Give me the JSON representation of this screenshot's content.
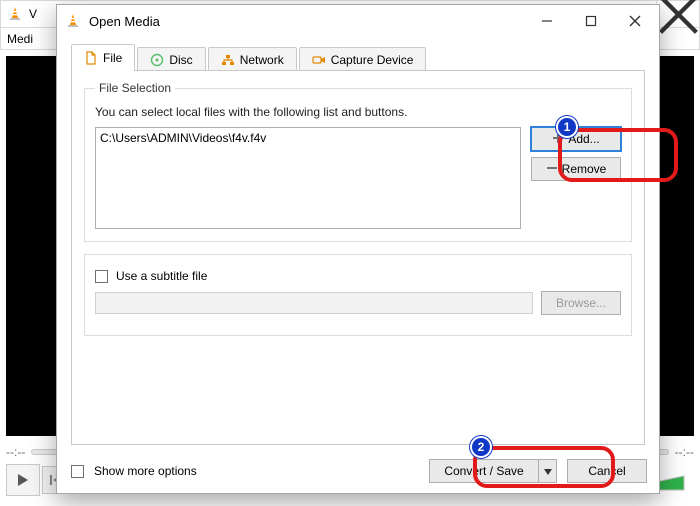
{
  "background": {
    "truncated_title": "V",
    "menu_first": "Medi",
    "seek_left": "--:--",
    "seek_right": "--:--"
  },
  "dialog": {
    "title": "Open Media",
    "tabs": {
      "file": "File",
      "disc": "Disc",
      "network": "Network",
      "capture": "Capture Device"
    },
    "file_selection": {
      "legend": "File Selection",
      "hint": "You can select local files with the following list and buttons.",
      "items": [
        "C:\\Users\\ADMIN\\Videos\\f4v.f4v"
      ],
      "add": "Add...",
      "remove": "Remove"
    },
    "subtitle": {
      "checkbox_label": "Use a subtitle file",
      "browse": "Browse..."
    },
    "footer": {
      "show_more": "Show more options",
      "convert": "Convert / Save",
      "cancel": "Cancel"
    }
  },
  "callouts": {
    "one": "1",
    "two": "2"
  }
}
